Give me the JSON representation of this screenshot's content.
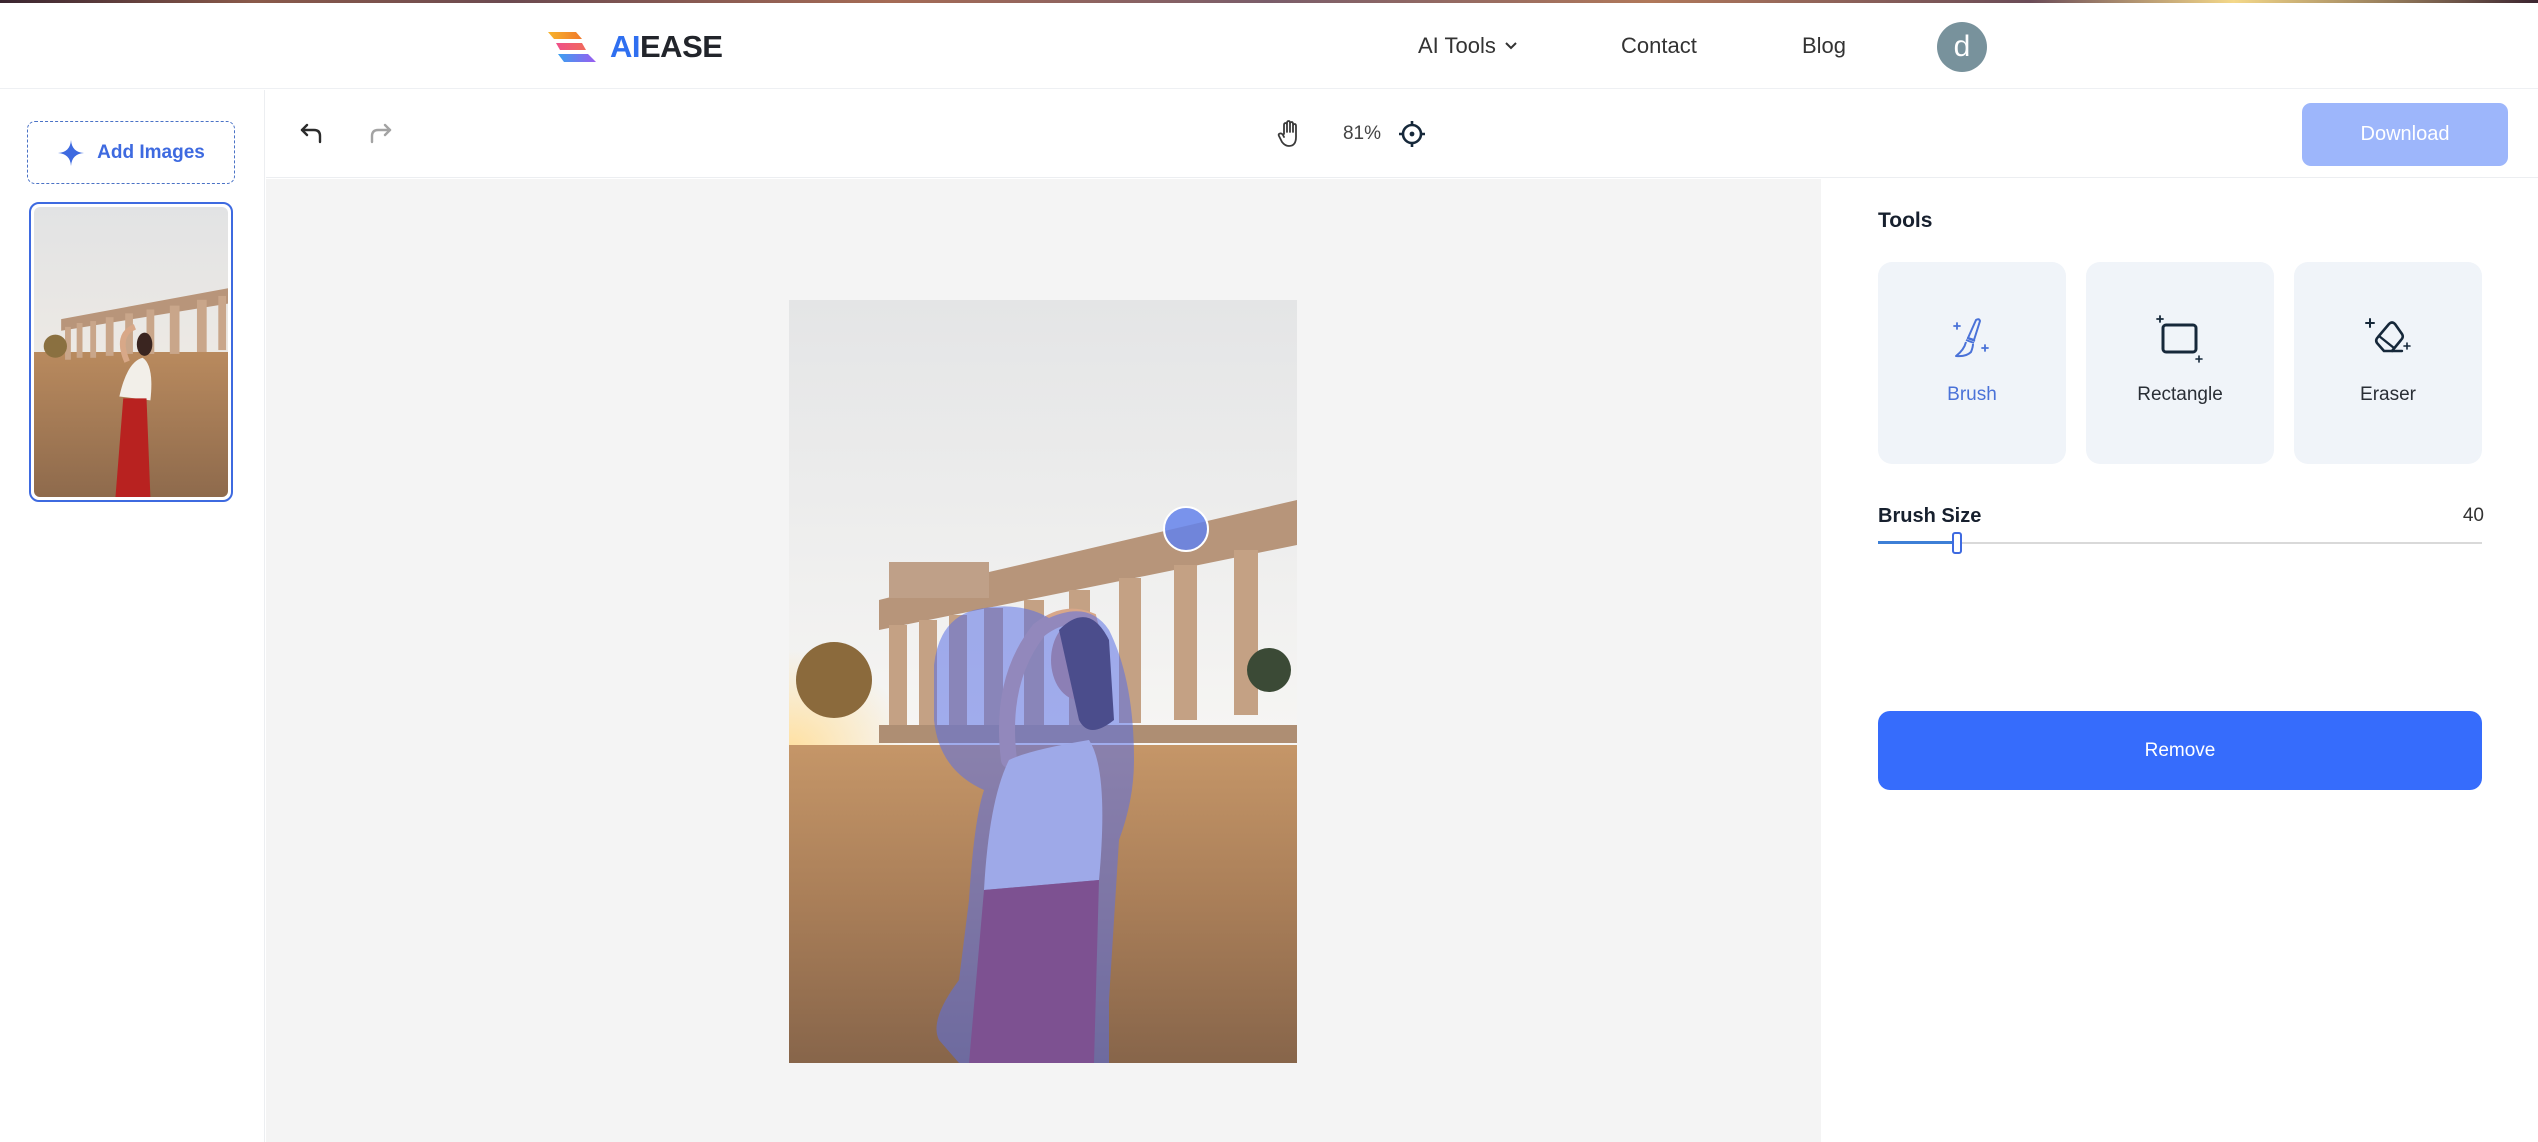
{
  "header": {
    "logo": {
      "ai": "AI",
      "ease": "EASE"
    },
    "nav": [
      {
        "label": "AI Tools",
        "has_dropdown": true
      },
      {
        "label": "Contact"
      },
      {
        "label": "Blog"
      }
    ],
    "avatar_letter": "d"
  },
  "sidebar": {
    "add_images_label": "Add Images",
    "thumbnails": [
      {
        "selected": true
      }
    ]
  },
  "toolbar": {
    "zoom_level": "81%",
    "download_label": "Download",
    "download_enabled": false,
    "icons": [
      "undo-icon",
      "redo-icon",
      "hand-icon",
      "target-icon"
    ]
  },
  "panel": {
    "tools_title": "Tools",
    "tools": [
      {
        "label": "Brush",
        "active": true
      },
      {
        "label": "Rectangle",
        "active": false
      },
      {
        "label": "Eraser",
        "active": false
      }
    ],
    "brush_size_label": "Brush Size",
    "brush_size_value": "40",
    "brush_size_fraction": 0.13,
    "remove_label": "Remove"
  },
  "colors": {
    "accent": "#366cfc",
    "download_disabled": "#9db6fb",
    "active_tool": "#4a72d8",
    "mask_overlay": "#5a6fe6"
  }
}
